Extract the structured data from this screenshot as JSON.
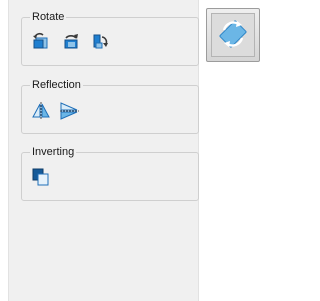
{
  "panel": {
    "rotate": {
      "title": "Rotate",
      "tools": [
        {
          "icon": "rotate-left-icon"
        },
        {
          "icon": "rotate-180-icon"
        },
        {
          "icon": "rotate-right-icon"
        }
      ]
    },
    "reflection": {
      "title": "Reflection",
      "tools": [
        {
          "icon": "flip-horizontal-icon"
        },
        {
          "icon": "flip-vertical-icon"
        }
      ]
    },
    "inverting": {
      "title": "Inverting",
      "tools": [
        {
          "icon": "invert-icon"
        }
      ]
    }
  },
  "main_button": {
    "icon": "rotate-sync-icon"
  },
  "colors": {
    "accent": "#1f7fd0",
    "icon_fill": "#6bb6e6"
  }
}
